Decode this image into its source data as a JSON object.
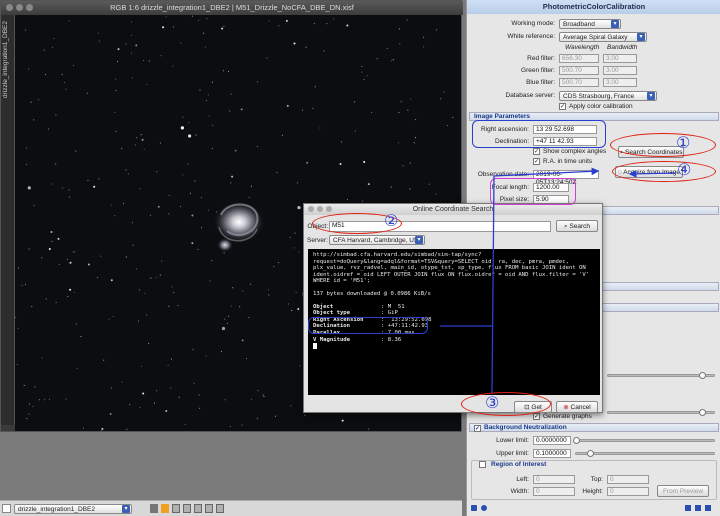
{
  "image_window": {
    "title": "RGB 1:6 drizzle_integration1_DBE2 | M51_Drizzle_NoCFA_DBE_DN.xisf",
    "side_tab": "drizzle_integration1_DBE2"
  },
  "bottom_bar": {
    "view_select": "drizzle_integration1_DBE2"
  },
  "panel": {
    "title": "PhotometricColorCalibration",
    "working_mode_label": "Working mode:",
    "working_mode_value": "Broadband",
    "white_reference_label": "White reference:",
    "white_reference_value": "Average Spiral Galaxy",
    "wavelength_header": "Wavelength",
    "bandwidth_header": "Bandwidth",
    "filters": [
      {
        "label": "Red filter:",
        "wavelength": "656.30",
        "bandwidth": "3.00"
      },
      {
        "label": "Green filter:",
        "wavelength": "500.70",
        "bandwidth": "3.00"
      },
      {
        "label": "Blue filter:",
        "wavelength": "500.70",
        "bandwidth": "3.00"
      }
    ],
    "database_server_label": "Database server:",
    "database_server_value": "CDS Strasbourg, France",
    "apply_color_calibration": "Apply color calibration",
    "image_parameters_section": "Image Parameters",
    "right_ascension_label": "Right ascension:",
    "right_ascension_value": "13 29 52.698",
    "declination_label": "Declination:",
    "declination_value": "+47 11 42.93",
    "search_coordinates": "Search Coordinates",
    "show_complex_angles": "Show complex angles",
    "ra_in_time_units": "R.A. in time units",
    "observation_date_label": "Observation date:",
    "observation_date_value": "2019-06-05T13:24:50Z",
    "acquire_from_image": "Acquire from Image",
    "focal_length_label": "Focal length:",
    "focal_length_value": "1200.00",
    "pixel_size_label": "Pixel size:",
    "pixel_size_value": "5.90",
    "generate_graphs": "Generate graphs",
    "background_neutralization_section": "Background Neutralization",
    "lower_limit_label": "Lower limit:",
    "lower_limit_value": "0.0000000",
    "upper_limit_label": "Upper limit:",
    "upper_limit_value": "0.1000000",
    "region_of_interest": "Region of Interest",
    "left_label": "Left:",
    "left_value": "0",
    "top_label": "Top:",
    "top_value": "0",
    "width_label": "Width:",
    "width_value": "0",
    "height_label": "Height:",
    "height_value": "0",
    "from_preview": "From Preview"
  },
  "dialog": {
    "title": "Online Coordinate Search",
    "object_label": "Object:",
    "object_value": "M51",
    "search_button": "Search",
    "server_label": "Server:",
    "server_value": "CFA Harvard, Cambridge, USA",
    "console_query": "http://simbad.cfa.harvard.edu/simbad/sim-tap/sync?\nrequest=doQuery&lang=adql&format=TSV&query=SELECT oid, ra, dec, pmra, pmdec,\nplx_value, rvz_radvel, main_id, otype_txt, sp_type, flux FROM basic JOIN ident ON\nident.oidref = oid LEFT OUTER JOIN flux ON flux.oidref = oid AND flux.filter = 'V'\nWHERE id = 'M51';",
    "console_downloaded": "137 bytes downloaded @ 0.0986 KiB/s",
    "result_rows": [
      {
        "key": "Object",
        "value": ": M  51"
      },
      {
        "key": "Object type",
        "value": ": GiP"
      },
      {
        "key": "Right Ascension",
        "value": ":  13:29:52.698"
      },
      {
        "key": "Declination",
        "value": ": +47:11:42.93"
      },
      {
        "key": "Parallax",
        "value": ": 7.00 mas"
      },
      {
        "key": "V Magnitude",
        "value": ": 8.36"
      }
    ],
    "get_button": "Get",
    "cancel_button": "Cancel"
  },
  "annotations": {
    "n1": "①",
    "n2": "②",
    "n3": "③",
    "n4": "④"
  },
  "colors": {
    "annotation_red": "#e02010",
    "annotation_blue": "#2a3fd0",
    "annotation_magenta": "#d040d0",
    "section_text": "#1a3a8a"
  }
}
